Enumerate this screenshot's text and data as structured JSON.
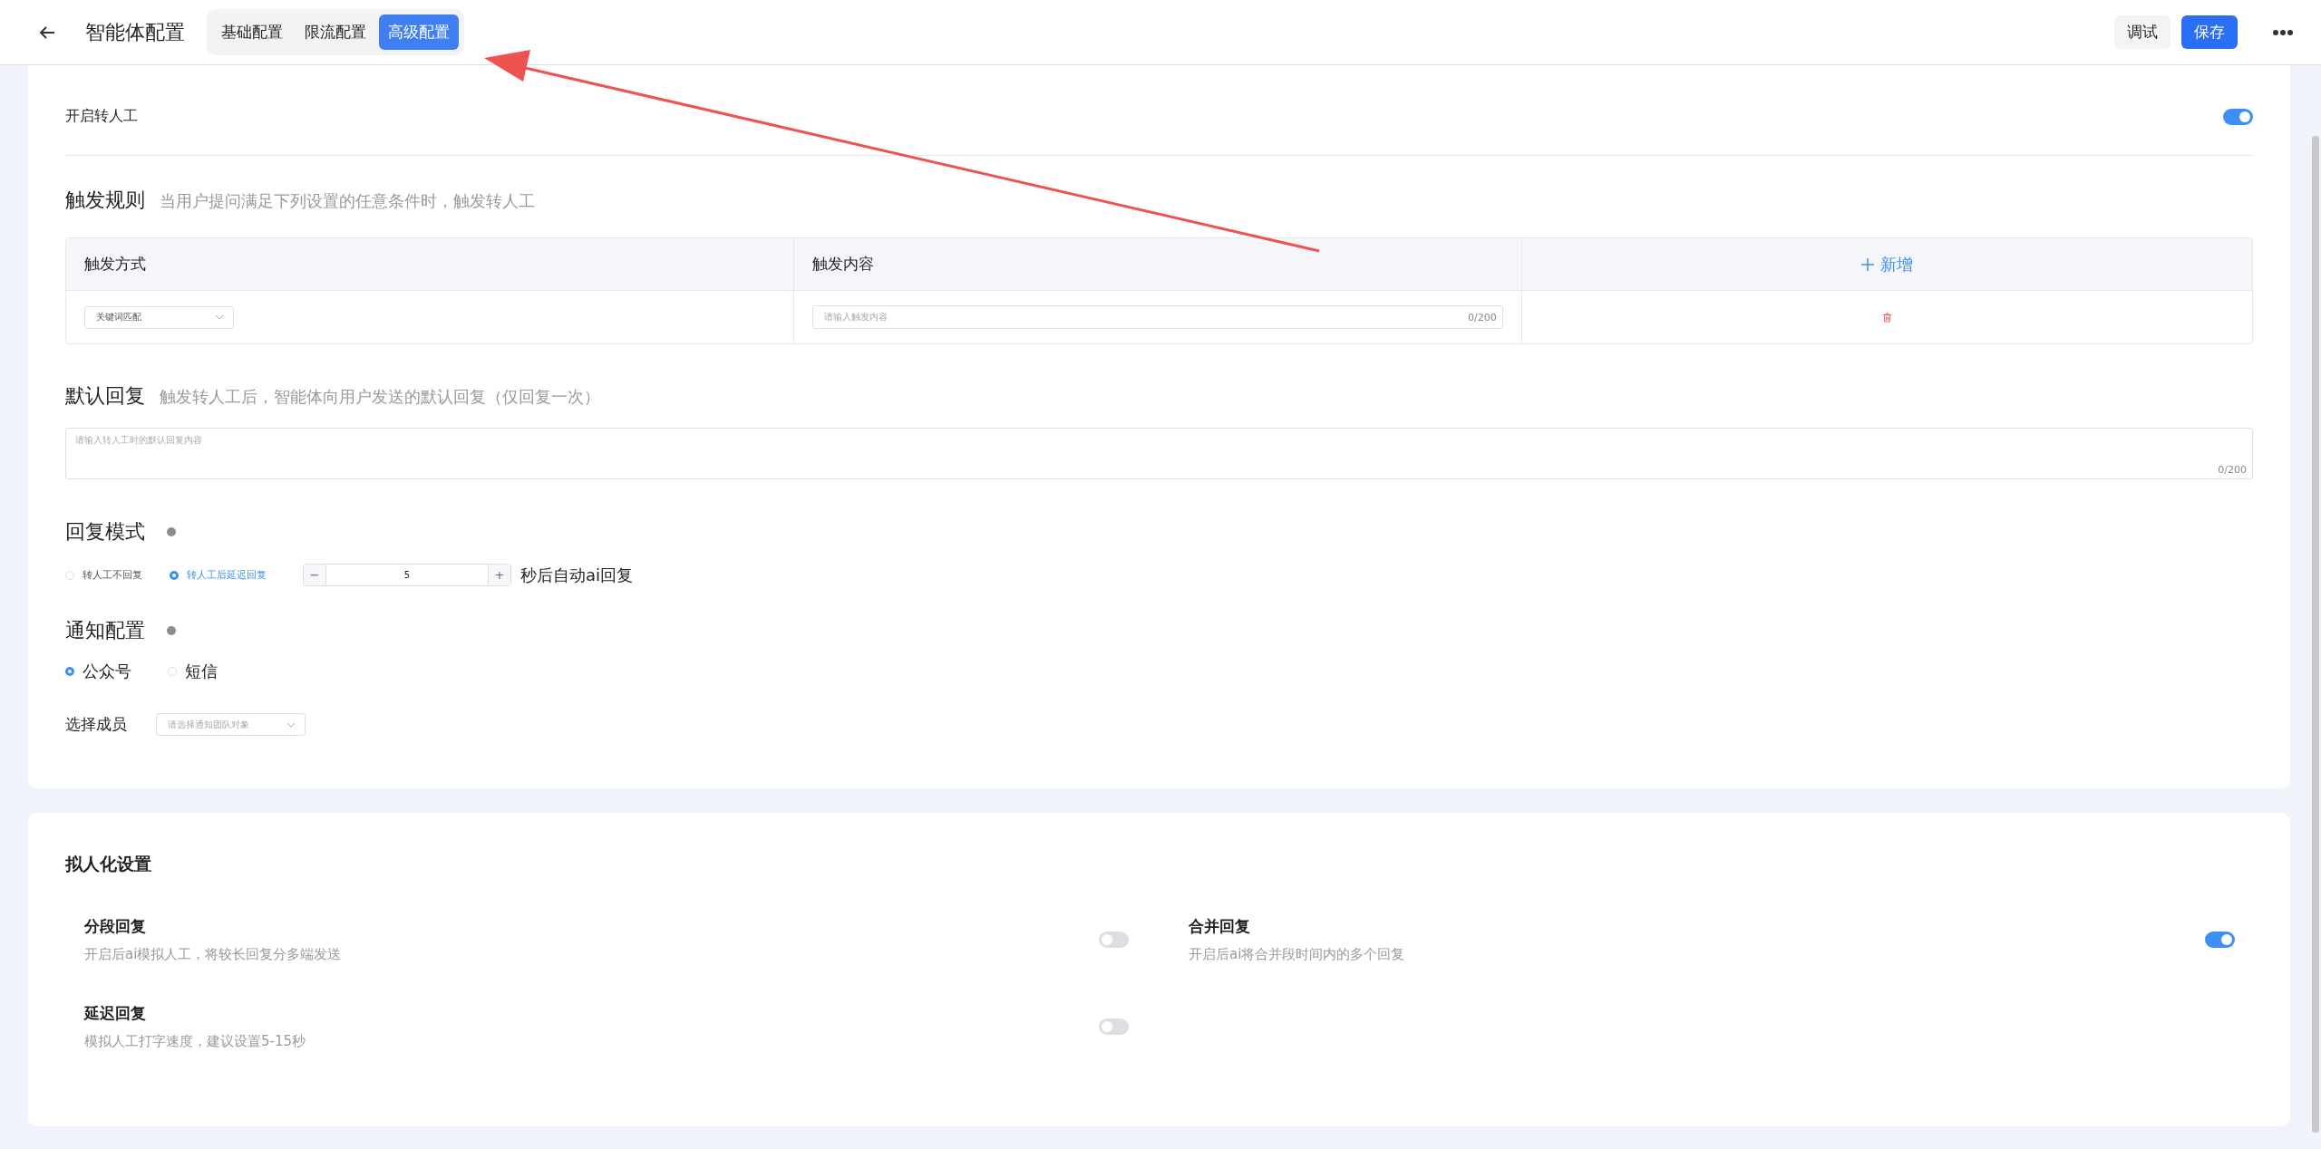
{
  "header": {
    "title": "智能体配置",
    "tabs": [
      {
        "label": "基础配置",
        "selected": false
      },
      {
        "label": "限流配置",
        "selected": false
      },
      {
        "label": "高级配置",
        "selected": true
      }
    ],
    "buttons": [
      {
        "label": "调试",
        "kind": "secondary"
      },
      {
        "label": "保存",
        "kind": "primary"
      }
    ]
  },
  "transfer": {
    "enable": {
      "label": "开启转人工",
      "on": true
    },
    "trigger_rules": {
      "title": "触发规则",
      "hint": "当用户提问满足下列设置的任意条件时，触发转人工",
      "columns": [
        "触发方式",
        "触发内容"
      ],
      "add_label": "新增",
      "rows": [
        {
          "method": "关键词匹配",
          "content_placeholder": "请输入触发内容",
          "counter": "0/200"
        }
      ]
    },
    "default_reply": {
      "title": "默认回复",
      "hint": "触发转人工后，智能体向用户发送的默认回复（仅回复一次）",
      "placeholder": "请输入转人工时的默认回复内容",
      "counter": "0/200"
    },
    "reply_mode": {
      "title": "回复模式",
      "options": [
        {
          "label": "转人工不回复",
          "selected": false
        },
        {
          "label": "转人工后延迟回复",
          "selected": true
        }
      ],
      "delay": {
        "minus": "−",
        "value": "5",
        "plus": "+"
      },
      "suffix": "秒后自动ai回复"
    },
    "notify": {
      "title": "通知配置",
      "channels": [
        {
          "label": "公众号",
          "selected": true
        },
        {
          "label": "短信",
          "selected": false
        }
      ],
      "member_label": "选择成员",
      "member_placeholder": "请选择通知团队对象"
    }
  },
  "persona": {
    "title": "拟人化设置",
    "items": [
      {
        "title": "分段回复",
        "desc": "开启后ai模拟人工，将较长回复分多端发送",
        "on": false
      },
      {
        "title": "合并回复",
        "desc": "开启后ai将合并段时间内的多个回复",
        "on": true
      },
      {
        "title": "延迟回复",
        "desc": "模拟人工打字速度，建议设置5-15秒",
        "on": false
      }
    ]
  }
}
